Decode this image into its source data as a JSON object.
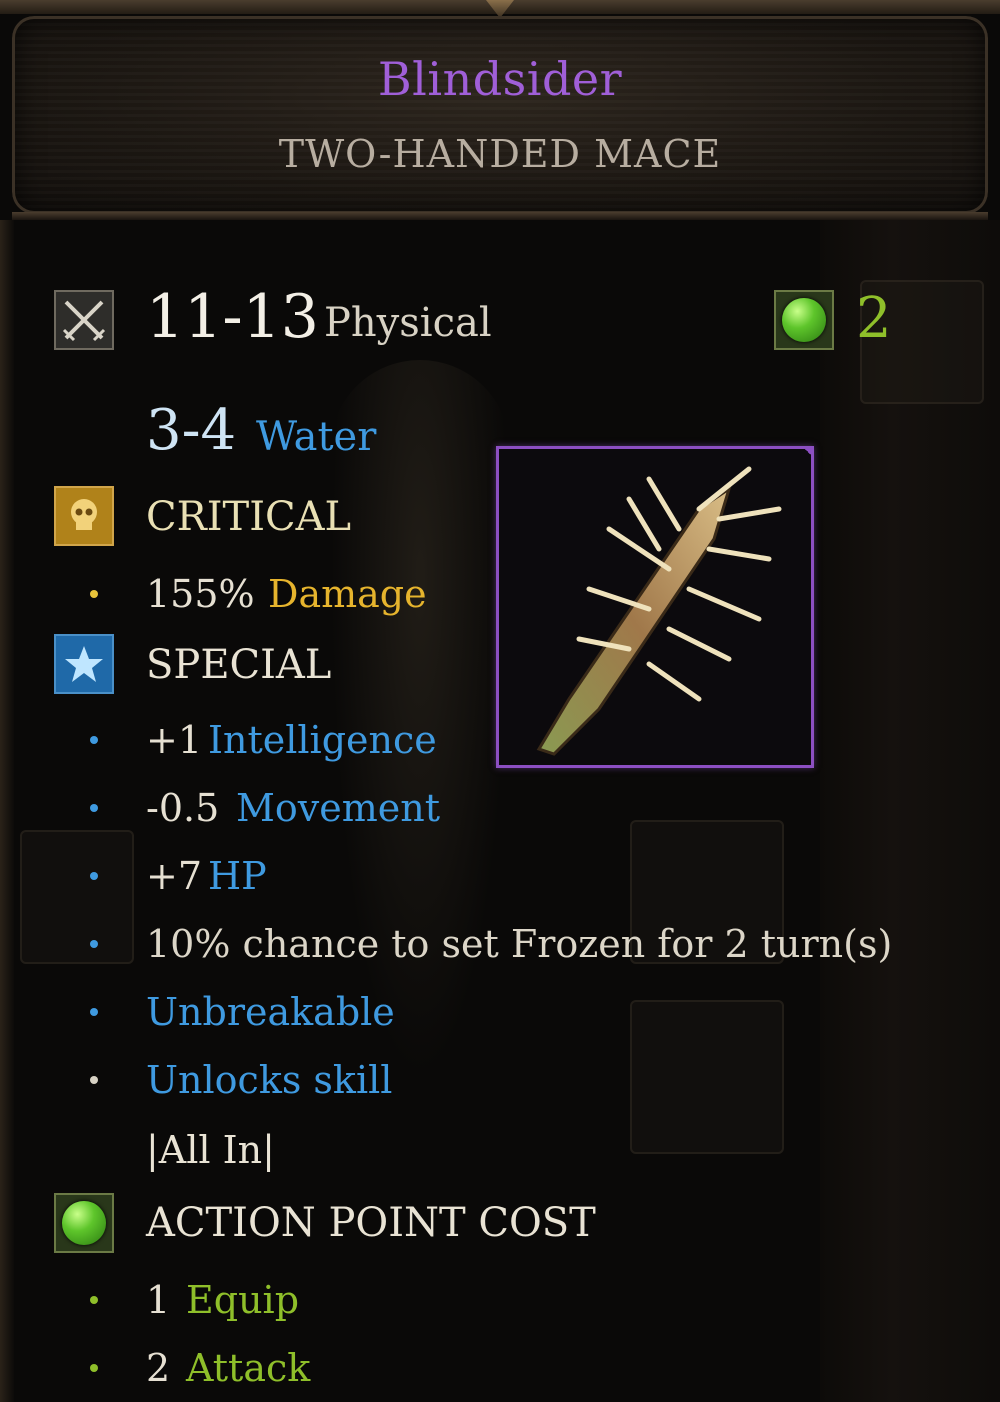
{
  "item": {
    "name": "Blindsider",
    "type": "TWO-HANDED MACE",
    "rarity_color": "#a05fd8"
  },
  "damage": {
    "primary_value": "11-13",
    "primary_type": "Physical",
    "secondary_value": "3-4",
    "secondary_type": "Water",
    "ap_cost": "2",
    "icon": "crossed-swords-icon"
  },
  "critical": {
    "heading": "CRITICAL",
    "icon": "skull-icon",
    "rows": [
      {
        "value": "155%",
        "label": "Damage"
      }
    ]
  },
  "special": {
    "heading": "SPECIAL",
    "icon": "star-icon",
    "rows": [
      {
        "value": "+1",
        "label": "Intelligence"
      },
      {
        "value": "-0.5",
        "label": "Movement"
      },
      {
        "value": "+7",
        "label": "HP"
      }
    ],
    "effect_text": "10% chance to set Frozen for 2 turn(s)",
    "unbreakable": "Unbreakable",
    "unlocks": "Unlocks skill",
    "skill_name": "|All In|"
  },
  "action_point_cost": {
    "heading": "ACTION POINT COST",
    "icon": "green-orb-icon",
    "rows": [
      {
        "value": "1",
        "label": "Equip"
      },
      {
        "value": "2",
        "label": "Attack"
      }
    ]
  },
  "colors": {
    "physical": "#d8d2c4",
    "water": "#3f9ae0",
    "critical": "#e6b42d",
    "ap": "#8fbf2a"
  }
}
